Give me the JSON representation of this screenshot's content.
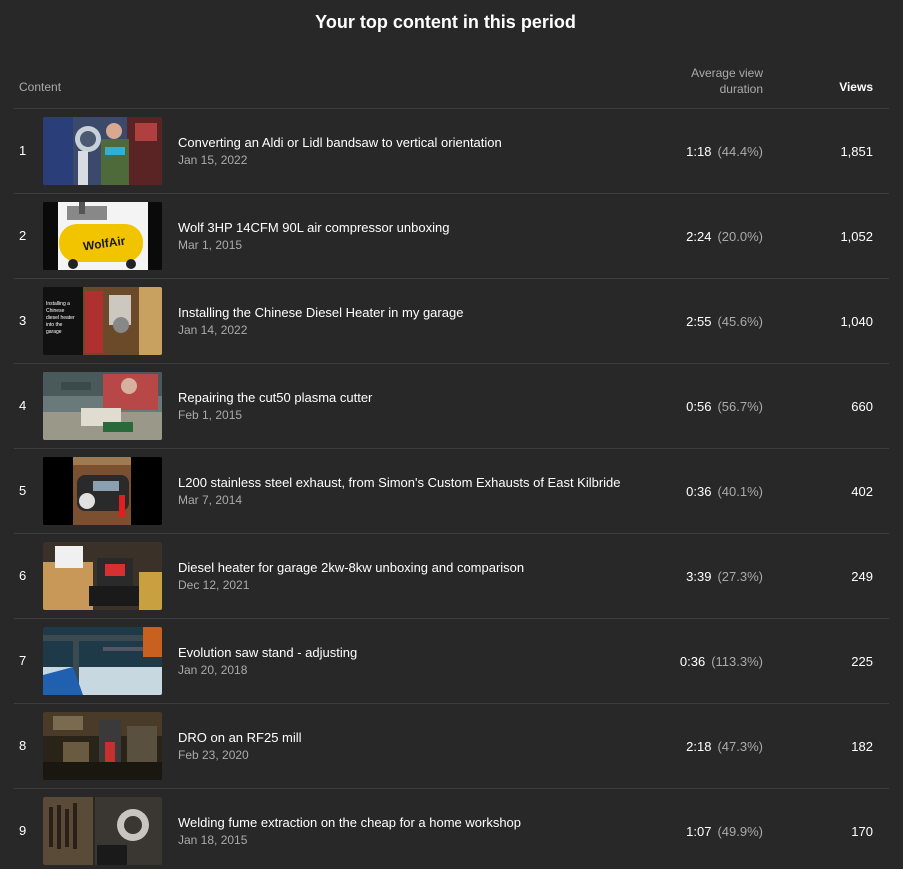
{
  "title": "Your top content in this period",
  "columns": {
    "content": "Content",
    "avd": "Average view duration",
    "views": "Views"
  },
  "rows": [
    {
      "rank": "1",
      "title": "Converting an Aldi or Lidl bandsaw to vertical orientation",
      "date": "Jan 15, 2022",
      "duration": "1:18",
      "percent": "(44.4%)",
      "views": "1,851"
    },
    {
      "rank": "2",
      "title": "Wolf 3HP 14CFM 90L air compressor unboxing",
      "date": "Mar 1, 2015",
      "duration": "2:24",
      "percent": "(20.0%)",
      "views": "1,052",
      "thumb_text": "WolfAir"
    },
    {
      "rank": "3",
      "title": "Installing the Chinese Diesel Heater in my garage",
      "date": "Jan 14, 2022",
      "duration": "2:55",
      "percent": "(45.6%)",
      "views": "1,040",
      "thumb_text": [
        "Installing a",
        "Chinese",
        "diesel heater",
        "into the",
        "garage"
      ]
    },
    {
      "rank": "4",
      "title": "Repairing the cut50 plasma cutter",
      "date": "Feb 1, 2015",
      "duration": "0:56",
      "percent": "(56.7%)",
      "views": "660"
    },
    {
      "rank": "5",
      "title": "L200 stainless steel exhaust, from Simon's Custom Exhausts of East Kilbride",
      "date": "Mar 7, 2014",
      "duration": "0:36",
      "percent": "(40.1%)",
      "views": "402"
    },
    {
      "rank": "6",
      "title": "Diesel heater for garage 2kw-8kw unboxing and comparison",
      "date": "Dec 12, 2021",
      "duration": "3:39",
      "percent": "(27.3%)",
      "views": "249"
    },
    {
      "rank": "7",
      "title": "Evolution saw stand - adjusting",
      "date": "Jan 20, 2018",
      "duration": "0:36",
      "percent": "(113.3%)",
      "views": "225"
    },
    {
      "rank": "8",
      "title": "DRO on an RF25 mill",
      "date": "Feb 23, 2020",
      "duration": "2:18",
      "percent": "(47.3%)",
      "views": "182"
    },
    {
      "rank": "9",
      "title": "Welding fume extraction on the cheap for a home workshop",
      "date": "Jan 18, 2015",
      "duration": "1:07",
      "percent": "(49.9%)",
      "views": "170"
    }
  ]
}
